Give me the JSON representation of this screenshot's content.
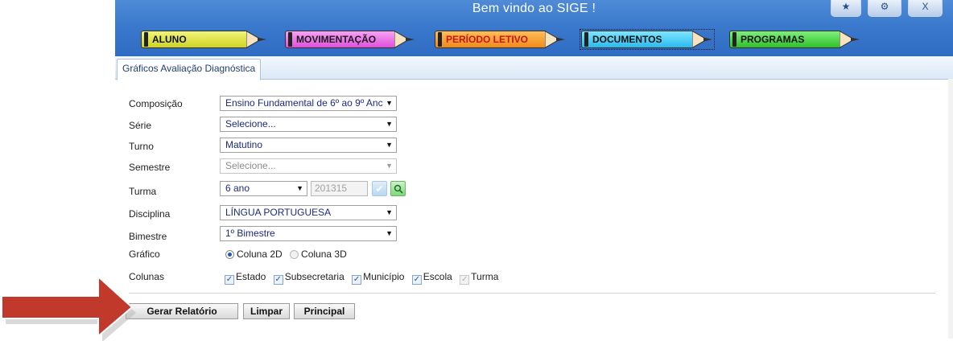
{
  "header": {
    "welcome_text": "Bem vindo ao SIGE !",
    "window_buttons": {
      "favorite_glyph": "★",
      "settings_glyph": "⚙",
      "close_glyph": "X"
    },
    "menu": [
      {
        "label": "ALUNO",
        "color": "#e3e84a"
      },
      {
        "label": "MOVIMENTAÇÃO",
        "color": "#ea72e6"
      },
      {
        "label": "PERÍODO LETIVO",
        "color": "#f6a33a"
      },
      {
        "label": "DOCUMENTOS",
        "color": "#4fcdf6"
      },
      {
        "label": "PROGRAMAS",
        "color": "#4fd74b"
      }
    ]
  },
  "tabs": [
    {
      "label": "Gráficos Avaliação Diagnóstica",
      "active": true
    }
  ],
  "form": {
    "composicao": {
      "label": "Composição",
      "value": "Ensino Fundamental de 6º ao 9º Anc"
    },
    "serie": {
      "label": "Série",
      "value": "Selecione..."
    },
    "turno": {
      "label": "Turno",
      "value": "Matutino"
    },
    "semestre": {
      "label": "Semestre",
      "value": "Selecione...",
      "disabled": true
    },
    "turma": {
      "label": "Turma",
      "value": "6 ano",
      "code": "201315"
    },
    "disciplina": {
      "label": "Disciplina",
      "value": "LÍNGUA PORTUGUESA"
    },
    "bimestre": {
      "label": "Bimestre",
      "value": "1º Bimestre"
    },
    "grafico": {
      "label": "Gráfico",
      "options": [
        "Coluna 2D",
        "Coluna 3D"
      ],
      "selected": "Coluna 2D"
    },
    "colunas": {
      "label": "Colunas",
      "options": [
        {
          "label": "Estado",
          "checked": true
        },
        {
          "label": "Subsecretaria",
          "checked": true
        },
        {
          "label": "Município",
          "checked": true
        },
        {
          "label": "Escola",
          "checked": true
        },
        {
          "label": "Turma",
          "checked": true,
          "disabled": true
        }
      ]
    }
  },
  "actions": {
    "gerar": "Gerar Relatório",
    "limpar": "Limpar",
    "principal": "Principal"
  },
  "colors": {
    "header_blue": "#3b79cd",
    "annotation_arrow": "#c0392b",
    "link_text": "#1c2a80"
  }
}
